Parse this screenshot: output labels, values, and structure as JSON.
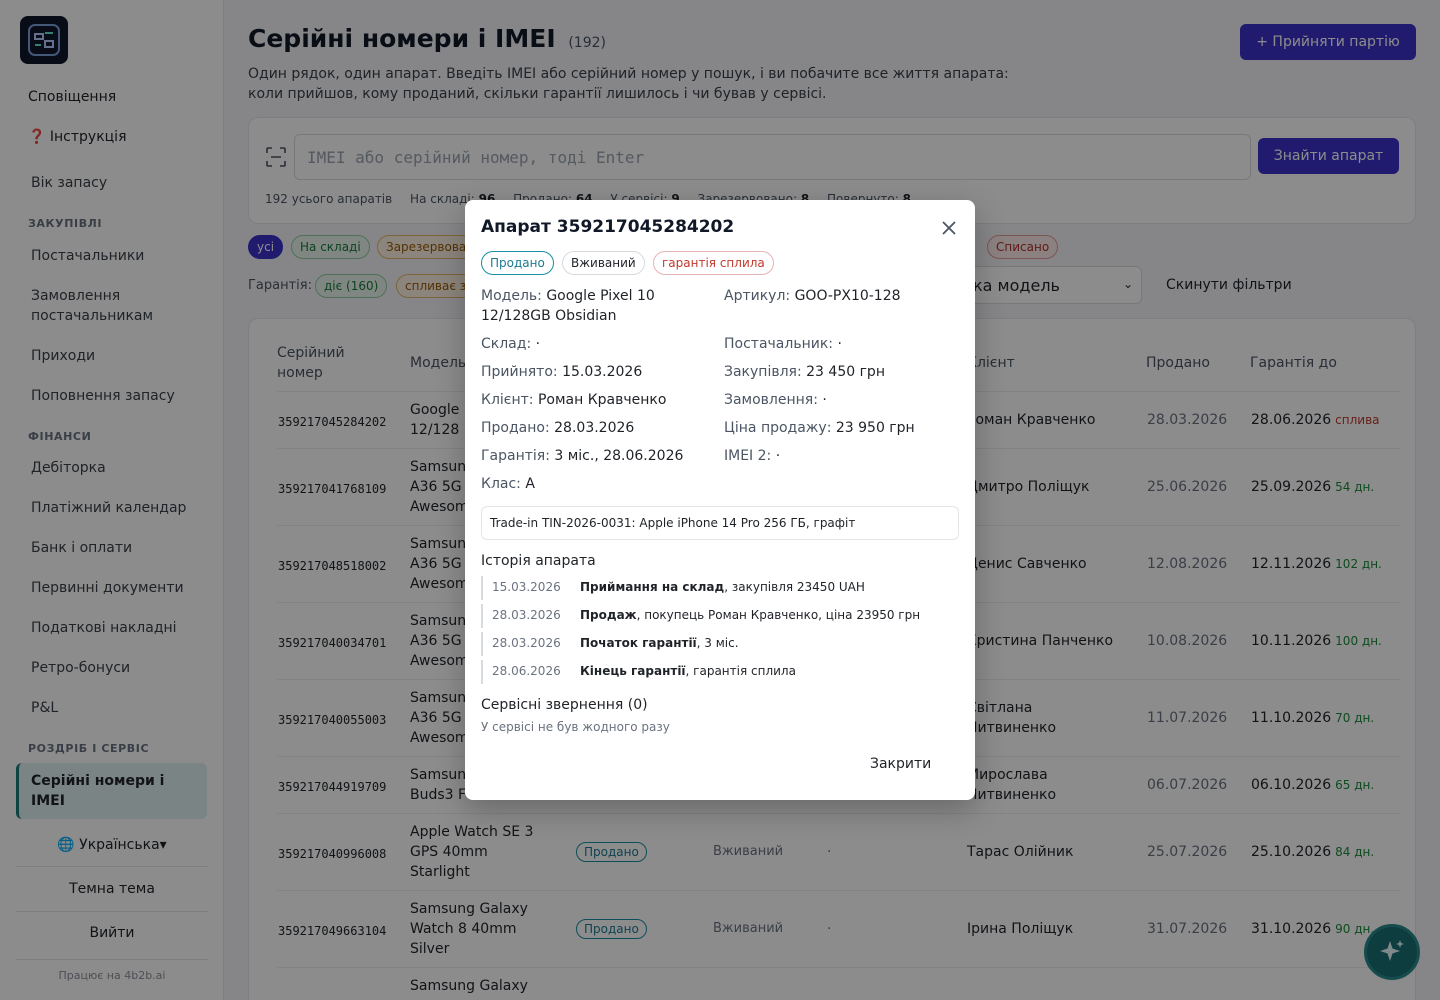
{
  "sidebar": {
    "notifications": "Сповіщення",
    "instruction": "❓ Інструкція",
    "stock_age": "Вік запасу",
    "section_purchases": "ЗАКУПІВЛІ",
    "suppliers": "Постачальники",
    "supplier_orders": "Замовлення постачальникам",
    "receipts": "Приходи",
    "replenishment": "Поповнення запасу",
    "section_finance": "ФІНАНСИ",
    "receivables": "Дебіторка",
    "payment_calendar": "Платіжний календар",
    "bank": "Банк і оплати",
    "primary_docs": "Первинні документи",
    "tax_invoices": "Податкові накладні",
    "retro_bonuses": "Ретро-бонуси",
    "pnl": "P&L",
    "section_retail": "РОЗДРІБ І СЕРВІС",
    "active_item": "Серійні номери і IMEI",
    "language": "🌐 Українська▾",
    "theme": "Темна тема",
    "logout": "Вийти",
    "powered": "Працює на 4b2b.ai"
  },
  "header": {
    "title": "Серійні номери і IMEI",
    "count": "(192)",
    "description": "Один рядок, один апарат. Введіть IMEI або серійний номер у пошук, і ви побачите все життя апарата: коли прийшов, кому проданий, скільки гарантії лишилось і чи бував у сервісі.",
    "accept_button": "+ Прийняти партію"
  },
  "search": {
    "placeholder": "IMEI або серійний номер, тоді Enter",
    "button": "Знайти апарат",
    "stats": {
      "total": "192 усього апаратів",
      "in_stock_label": "На складі:",
      "in_stock": "96",
      "sold_label": "Продано:",
      "sold": "64",
      "service_label": "У сервісі:",
      "service": "9",
      "reserved_label": "Зарезервовано:",
      "reserved": "8",
      "returned_label": "Повернуто:",
      "returned": "8"
    }
  },
  "filters": {
    "status_chips": [
      "усі",
      "На складі",
      "Зарезервова",
      "Списано"
    ],
    "warranty_label": "Гарантія:",
    "warranty_chips": [
      "діє (160)",
      "спливає з"
    ],
    "model_select": "ка модель",
    "reset": "Скинути фільтри"
  },
  "table": {
    "headers": {
      "serial": "Серійний номер",
      "model": "Модель",
      "client": "Клієнт",
      "sold": "Продано",
      "warranty": "Гарантія до"
    },
    "rows": [
      {
        "serial": "359217045284202",
        "model": "Google\n12/128",
        "client": "Роман Кравченко",
        "sold": "28.03.2026",
        "warranty": "28.06.2026",
        "tag": "сплива"
      },
      {
        "serial": "359217041768109",
        "model": "Samsun\nA36 5G\nAwesom",
        "client": "Дмитро Поліщук",
        "sold": "25.06.2026",
        "warranty": "25.09.2026",
        "tag": "54 дн."
      },
      {
        "serial": "359217048518002",
        "model": "Samsun\nA36 5G\nAwesom",
        "client": "Денис Савченко",
        "sold": "12.08.2026",
        "warranty": "12.11.2026",
        "tag": "102 дн."
      },
      {
        "serial": "359217040034701",
        "model": "Samsun\nA36 5G\nAwesom",
        "client": "Христина Панченко",
        "sold": "10.08.2026",
        "warranty": "10.11.2026",
        "tag": "100 дн."
      },
      {
        "serial": "359217040055003",
        "model": "Samsun\nA36 5G\nAwesom",
        "client": "Світлана\nЛитвиненко",
        "sold": "11.07.2026",
        "warranty": "11.10.2026",
        "tag": "70 дн."
      },
      {
        "serial": "359217044919709",
        "model": "Samsun\nBuds3 F",
        "client": "Мирослава\nЛитвиненко",
        "sold": "06.07.2026",
        "warranty": "06.10.2026",
        "tag": "65 дн."
      },
      {
        "serial": "359217040996008",
        "model": "Apple Watch SE 3\nGPS 40mm\nStarlight",
        "status": "Продано",
        "condition": "Вживаний",
        "order": "·",
        "client": "Тарас Олійник",
        "sold": "25.07.2026",
        "warranty": "25.10.2026",
        "tag": "84 дн."
      },
      {
        "serial": "359217049663104",
        "model": "Samsung Galaxy\nWatch 8 40mm\nSilver",
        "status": "Продано",
        "condition": "Вживаний",
        "order": "·",
        "client": "Ірина Поліщук",
        "sold": "31.07.2026",
        "warranty": "31.10.2026",
        "tag": "90 дн."
      },
      {
        "serial": "",
        "model": "Samsung Galaxy",
        "client": "",
        "sold": "",
        "warranty": "",
        "tag": ""
      }
    ]
  },
  "modal": {
    "title": "Апарат 359217045284202",
    "badges": [
      "Продано",
      "Вживаний",
      "гарантія сплила"
    ],
    "fields": {
      "model_k": "Модель:",
      "model_v": "Google Pixel 10 12/128GB Obsidian",
      "sku_k": "Артикул:",
      "sku_v": "GOO-PX10-128",
      "warehouse_k": "Склад:",
      "warehouse_v": "·",
      "supplier_k": "Постачальник:",
      "supplier_v": "·",
      "accepted_k": "Прийнято:",
      "accepted_v": "15.03.2026",
      "purchase_k": "Закупівля:",
      "purchase_v": "23 450 грн",
      "client_k": "Клієнт:",
      "client_v": "Роман Кравченко",
      "order_k": "Замовлення:",
      "order_v": "·",
      "sold_k": "Продано:",
      "sold_v": "28.03.2026",
      "price_k": "Ціна продажу:",
      "price_v": "23 950 грн",
      "warranty_k": "Гарантія:",
      "warranty_v": "3 міс., 28.06.2026",
      "imei2_k": "IMEI 2:",
      "imei2_v": "·",
      "class_k": "Клас:",
      "class_v": "A"
    },
    "note": "Trade-in TIN-2026-0031: Apple iPhone 14 Pro 256 ГБ, графіт",
    "history_title": "Історія апарата",
    "history": [
      {
        "date": "15.03.2026",
        "event": "Приймання на склад",
        "detail": ", закупівля 23450 UAH"
      },
      {
        "date": "28.03.2026",
        "event": "Продаж",
        "detail": ", покупець Роман Кравченко, ціна 23950 грн"
      },
      {
        "date": "28.03.2026",
        "event": "Початок гарантії",
        "detail": ", 3 міс."
      },
      {
        "date": "28.06.2026",
        "event": "Кінець гарантії",
        "detail": ", гарантія сплила"
      }
    ],
    "service_title": "Сервісні звернення (0)",
    "service_empty": "У сервісі не був жодного разу",
    "close": "Закрити"
  },
  "colors": {
    "primary": "#3b32c9",
    "accent": "#1b7a7a",
    "ok": "#1a8a3a",
    "danger": "#c0392b"
  }
}
